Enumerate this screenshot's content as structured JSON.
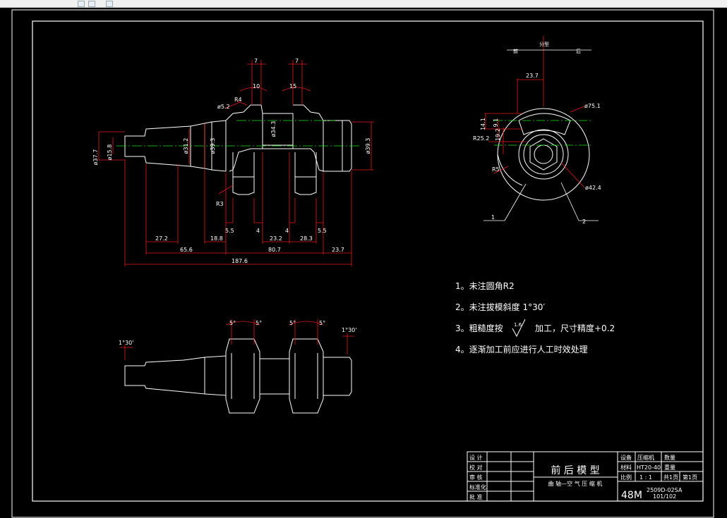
{
  "window": {
    "icons": [
      "back-icon",
      "forward-icon",
      "refresh-icon"
    ]
  },
  "dims_front": {
    "d_left_outer": "ø37.7",
    "d_left_inner": "ø15.8",
    "d_shaft_a": "ø31.2",
    "d_shaft_b": "ø39.3",
    "d_pin": "ø34.3",
    "d_right": "ø39.3",
    "d_fillet": "ø5.2",
    "r4": "R4",
    "r3": "R3",
    "seven_a": "7",
    "seven_b": "7",
    "ten": "10",
    "fifteen": "15",
    "l_55a": "5.5",
    "l_4a": "4",
    "l_232": "23.2",
    "l_4b": "4",
    "l_283": "28.3",
    "l_55b": "5.5",
    "l_272": "27.2",
    "l_188": "18.8",
    "l_656": "65.6",
    "l_807": "80.7",
    "l_237": "23.7",
    "l_1876": "187.6"
  },
  "dims_side": {
    "top_label": "分型",
    "front_label": "前",
    "rear_label": "后",
    "w_237": "23.7",
    "d_751": "ø75.1",
    "d_252": "R25.2",
    "d_424": "ø42.4",
    "h_141": "14.1",
    "h_91": "9.1",
    "h_192": "19.2",
    "r5": "R5",
    "callout1": "1",
    "callout2": "2"
  },
  "dims_bottom": {
    "taper_left": "1°30'",
    "taper_right": "1°30'",
    "ang1": "5°",
    "ang2": "5°",
    "ang3": "5°",
    "ang4": "5°"
  },
  "notes": [
    "1。未注圆角R2",
    "2。未注拔模斜度 1°30′",
    "3。粗糙度按",
    "4。逐渐加工前应进行人工时效处理"
  ],
  "note3_rough": "1.6",
  "note3_tail": "加工，尺寸精度+0.2",
  "title_block": {
    "rows": [
      "设 计",
      "校 对",
      "审 核",
      "标准化",
      "批 准"
    ],
    "title": "前 后 模 型",
    "subtitle": "曲 轴—空 气 压 缩 机",
    "lbl_equip": "设备",
    "val_equip": "压缩机",
    "lbl_qty": "数量",
    "lbl_mat": "材料",
    "val_mat": "HT20-40",
    "lbl_weight": "重量",
    "lbl_scale": "比例",
    "val_scale": "1 : 1",
    "sheet_total": "共1页",
    "sheet_no": "第1页",
    "code_main": "48M",
    "code_num": "2509D-02SA",
    "code_sub": "101/102"
  }
}
